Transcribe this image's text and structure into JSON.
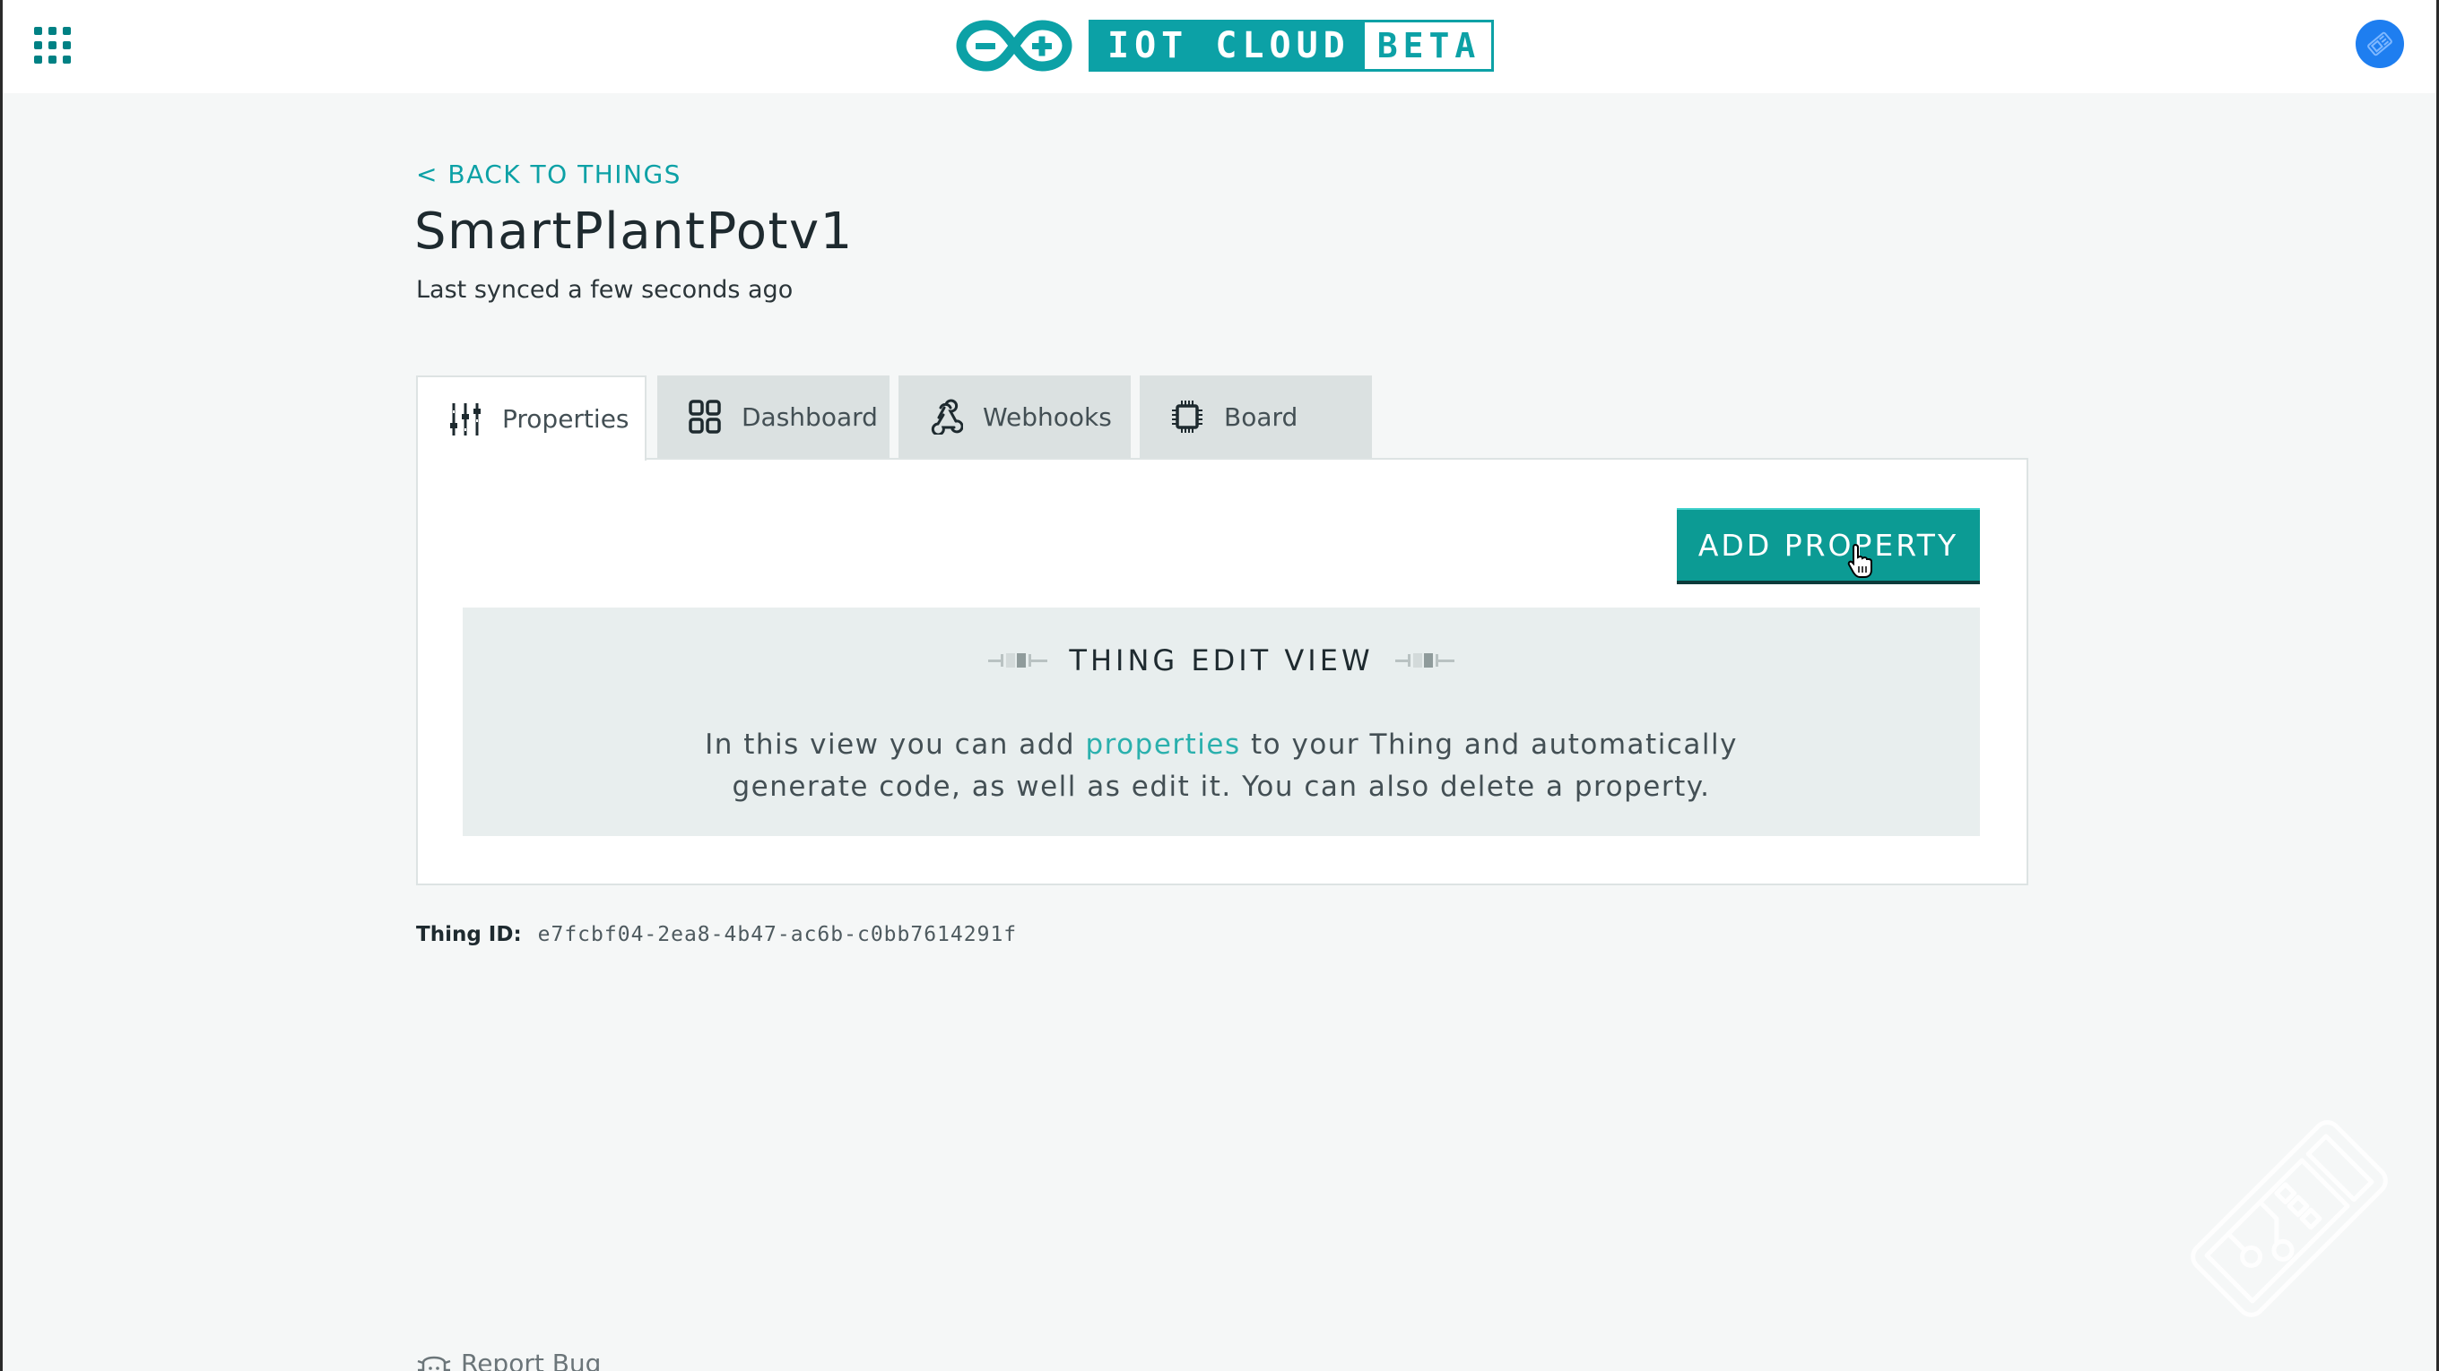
{
  "header": {
    "apps_icon": "apps-grid-icon",
    "logo": {
      "primary": "IOT CLOUD",
      "secondary": "BETA",
      "brand_color": "#0ca1a6"
    },
    "avatar_icon": "board-badge-icon",
    "avatar_color": "#1e7ef0"
  },
  "page": {
    "back_link": "< BACK TO THINGS",
    "title": "SmartPlantPotv1",
    "synced": "Last synced a few seconds ago"
  },
  "tabs": [
    {
      "label": "Properties",
      "icon": "sliders-icon",
      "active": true
    },
    {
      "label": "Dashboard",
      "icon": "dashboard-grid-icon",
      "active": false
    },
    {
      "label": "Webhooks",
      "icon": "webhook-icon",
      "active": false
    },
    {
      "label": "Board",
      "icon": "chip-icon",
      "active": false
    }
  ],
  "panel": {
    "add_button": "ADD PROPERTY",
    "info_title": "THING EDIT VIEW",
    "info_text_before": "In this view you can add ",
    "info_link": "properties",
    "info_text_after_line1": " to your Thing and automatically",
    "info_text_line2": "generate code, as well as edit it. You can also delete a property."
  },
  "thing_id": {
    "label": "Thing ID:",
    "value": "e7fcbf04-2ea8-4b47-ac6b-c0bb7614291f"
  },
  "footer": {
    "report_bug": "Report Bug"
  },
  "colors": {
    "accent": "#0ca1a6",
    "button": "#0c9b94",
    "background": "#f5f7f7",
    "tab_inactive": "#dbe1e1",
    "info_box": "#e8eeee"
  }
}
